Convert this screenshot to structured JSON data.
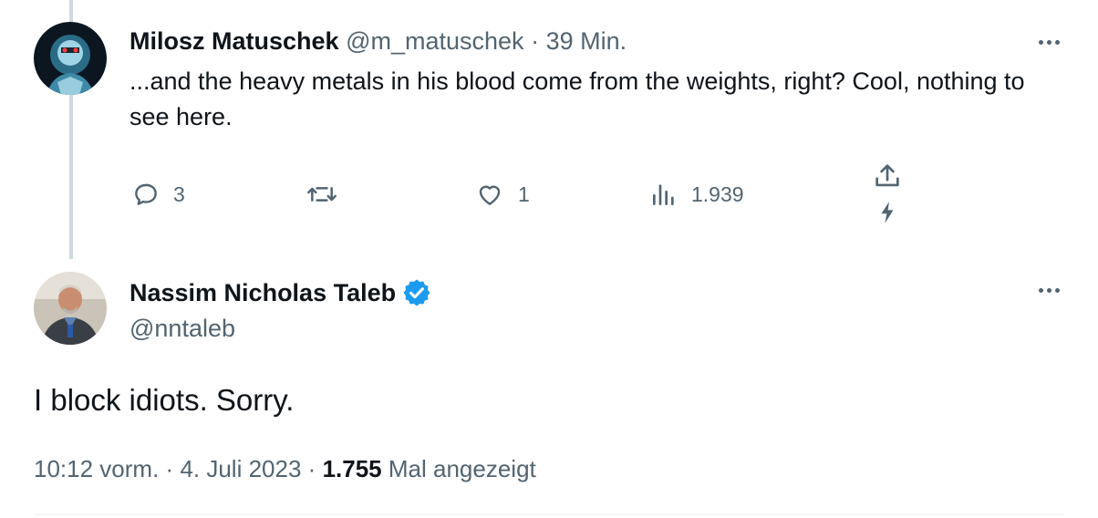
{
  "reply": {
    "name": "Milosz Matuschek",
    "handle": "@m_matuschek",
    "separator": "·",
    "time": "39 Min.",
    "text": "...and the heavy metals in his blood come from the weights, right? Cool, nothing to see here.",
    "actions": {
      "reply_count": "3",
      "retweet_count": "",
      "like_count": "1",
      "views_count": "1.939"
    },
    "icons": [
      "reply-icon",
      "retweet-icon",
      "like-icon",
      "views-icon",
      "share-icon",
      "flash-icon",
      "more-icon"
    ]
  },
  "tweet": {
    "name": "Nassim Nicholas Taleb",
    "handle": "@nntaleb",
    "verified_color": "#1d9bf0",
    "text": "I block idiots. Sorry.",
    "time": "10:12 vorm.",
    "separator": "·",
    "date": "4. Juli 2023",
    "views": "1.755",
    "views_label": "Mal angezeigt"
  },
  "colors": {
    "text": "#0f1419",
    "muted": "#536471",
    "thread_line": "#cfd9de",
    "accent": "#1d9bf0"
  }
}
